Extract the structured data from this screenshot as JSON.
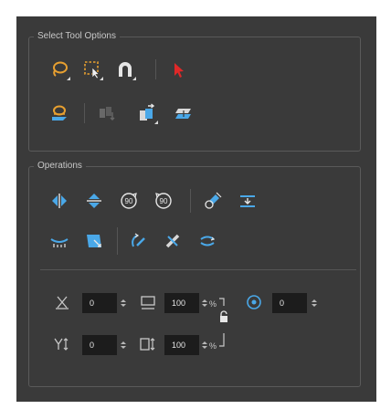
{
  "select_tool_options": {
    "title": "Select Tool Options",
    "row1": [
      "lasso-icon",
      "marquee-select-icon",
      "snap-magnet-icon",
      "select-arrow-icon"
    ],
    "row2": [
      "apply-to-all-layers-icon",
      "reposition-drawings-icon",
      "create-drawing-icon",
      "flatten-icon"
    ]
  },
  "operations": {
    "title": "Operations",
    "row1": [
      "flip-horizontal-icon",
      "flip-vertical-icon",
      "rotate-90-cw-icon",
      "rotate-90-ccw-icon",
      "dropper-icon",
      "distribute-to-layers-icon"
    ],
    "row2": [
      "smooth-icon",
      "merge-icon",
      "convert-to-pencil-icon",
      "pencil-to-brush-icon",
      "optimize-icon"
    ],
    "rotate_cw_label": "90",
    "rotate_ccw_label": "90"
  },
  "fields": {
    "x_offset": "0",
    "y_offset": "0",
    "width_percent": "100",
    "height_percent": "100",
    "rotation": "0",
    "percent_label": "%"
  },
  "colors": {
    "panel_bg": "#3a3a3a",
    "field_bg": "#1c1c1c",
    "accent_blue": "#4aa8e8",
    "accent_orange": "#e8a030",
    "accent_red": "#e02828"
  }
}
